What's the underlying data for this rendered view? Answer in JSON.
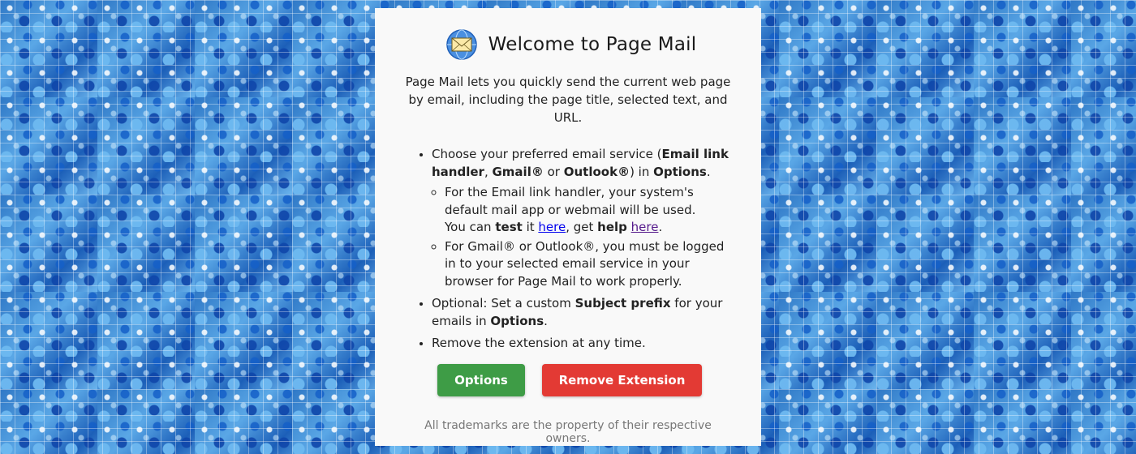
{
  "header": {
    "logo_icon": "envelope-globe-icon",
    "title": "Welcome to Page Mail"
  },
  "intro": "Page Mail lets you quickly send the current web page by email, including the page title, selected text, and URL.",
  "list": {
    "item1": {
      "t1": "Choose your preferred email service (",
      "b1": "Email link handler",
      "t2": ", ",
      "b2": "Gmail®",
      "t3": " or ",
      "b3": "Outlook®",
      "t4": ") in ",
      "b4": "Options",
      "t5": "."
    },
    "sub1": {
      "line1": "For the Email link handler, your system's default mail app or webmail will be used.",
      "t1": "You can ",
      "b1": "test",
      "t2": " it ",
      "link1": "here",
      "t3": ", get ",
      "b2": "help",
      "t4": " ",
      "link2": "here",
      "t5": "."
    },
    "sub2": "For Gmail® or Outlook®, you must be logged in to your selected email service in your browser for Page Mail to work properly.",
    "item2": {
      "t1": "Optional: Set a custom ",
      "b1": "Subject prefix",
      "t2": " for your emails in ",
      "b2": "Options",
      "t3": "."
    },
    "item3": "Remove the extension at any time."
  },
  "buttons": {
    "options_label": "Options",
    "remove_label": "Remove Extension"
  },
  "footer": "All trademarks are the property of their respective owners.",
  "colors": {
    "options_button": "#3e9c46",
    "remove_button": "#e33a34",
    "link": "#0000ee",
    "visited_link": "#551a8b"
  }
}
